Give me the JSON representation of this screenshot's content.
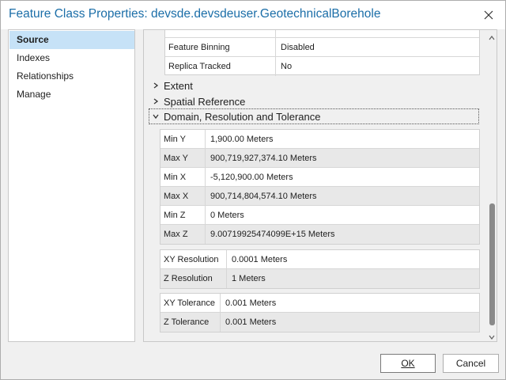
{
  "window": {
    "title": "Feature Class Properties: devsde.devsdeuser.GeotechnicalBorehole"
  },
  "nav": {
    "items": [
      {
        "label": "Source",
        "active": true
      },
      {
        "label": "Indexes",
        "active": false
      },
      {
        "label": "Relationships",
        "active": false
      },
      {
        "label": "Manage",
        "active": false
      }
    ]
  },
  "top_table": {
    "rows": [
      {
        "key": "Feature Binning",
        "value": "Disabled"
      },
      {
        "key": "Replica Tracked",
        "value": "No"
      }
    ]
  },
  "sections": {
    "extent": "Extent",
    "spatial_reference": "Spatial Reference",
    "domain": "Domain, Resolution and Tolerance"
  },
  "domain_table": {
    "rows": [
      {
        "key": "Min Y",
        "value": "1,900.00 Meters"
      },
      {
        "key": "Max Y",
        "value": "900,719,927,374.10 Meters"
      },
      {
        "key": "Min X",
        "value": "-5,120,900.00 Meters"
      },
      {
        "key": "Max X",
        "value": "900,714,804,574.10 Meters"
      },
      {
        "key": "Min Z",
        "value": "0 Meters"
      },
      {
        "key": "Max Z",
        "value": "9.00719925474099E+15 Meters"
      }
    ]
  },
  "resolution_table": {
    "rows": [
      {
        "key": "XY Resolution",
        "value": "0.0001 Meters"
      },
      {
        "key": "Z Resolution",
        "value": "1 Meters"
      }
    ]
  },
  "tolerance_table": {
    "rows": [
      {
        "key": "XY Tolerance",
        "value": "0.001 Meters"
      },
      {
        "key": "Z Tolerance",
        "value": "0.001 Meters"
      }
    ]
  },
  "buttons": {
    "ok": "OK",
    "cancel": "Cancel"
  },
  "colors": {
    "title": "#1b6ea8",
    "nav_selected": "#c6e2f7",
    "alt_row": "#e8e8e8",
    "scroll_thumb": "#8a8a8a"
  }
}
